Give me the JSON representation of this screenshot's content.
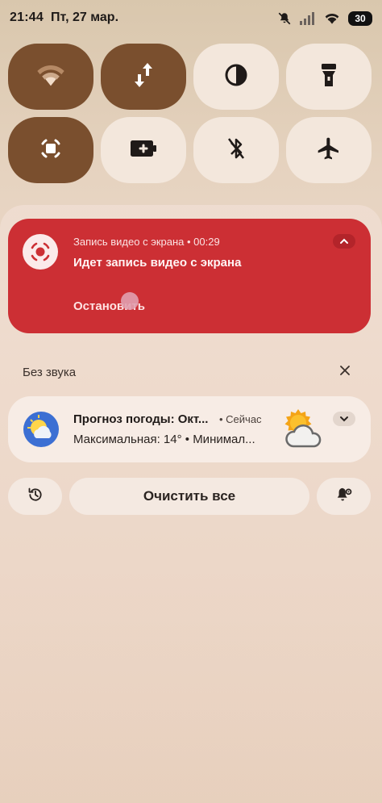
{
  "status_bar": {
    "time": "21:44",
    "date": "Пт, 27 мар.",
    "battery": "30",
    "icons": [
      "mute-icon",
      "signal-icon",
      "wifi-icon",
      "battery-icon"
    ]
  },
  "quick_tiles": [
    {
      "name": "wifi",
      "icon": "wifi-icon",
      "active": true
    },
    {
      "name": "mobile-data",
      "icon": "data-arrows-icon",
      "active": true
    },
    {
      "name": "dark-theme",
      "icon": "contrast-icon",
      "active": false
    },
    {
      "name": "flashlight",
      "icon": "flashlight-icon",
      "active": false
    },
    {
      "name": "screen-record",
      "icon": "screen-record-icon",
      "active": true
    },
    {
      "name": "battery-saver",
      "icon": "battery-plus-icon",
      "active": false
    },
    {
      "name": "bluetooth",
      "icon": "bluetooth-off-icon",
      "active": false
    },
    {
      "name": "airplane-mode",
      "icon": "airplane-icon",
      "active": false
    }
  ],
  "recording_notification": {
    "app_line": "Запись видео с экрана • 00:29",
    "title": "Идет запись видео с экрана",
    "action": "Остановить",
    "color": "#cc2f34"
  },
  "silent_section": {
    "label": "Без звука"
  },
  "weather_notification": {
    "title": "Прогноз погоды: Окт...",
    "time": "• Сейчас",
    "text": "Максимальная: 14° • Минимал..."
  },
  "actions": {
    "clear_all": "Очистить все"
  },
  "colors": {
    "tile_active": "#7a4f2e",
    "tile_inactive": "#f3e7dc",
    "record_card": "#cc2f34"
  }
}
